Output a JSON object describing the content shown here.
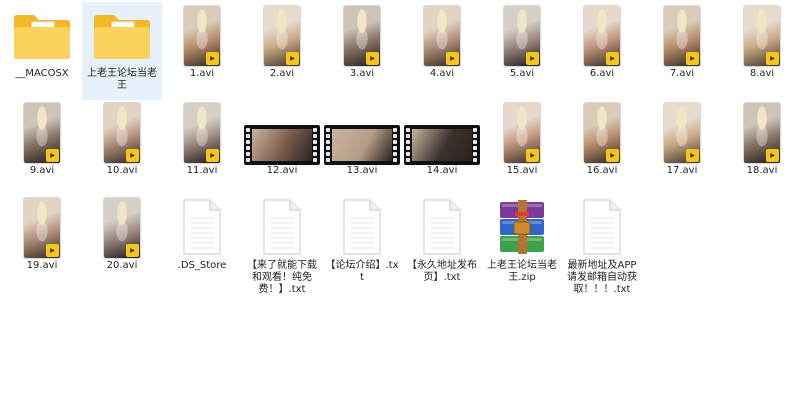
{
  "items": [
    {
      "label": "__MACOSX",
      "kind": "folder"
    },
    {
      "label": "上老王论坛当老王",
      "kind": "folder",
      "selected": true
    },
    {
      "label": "1.avi",
      "kind": "pvideo"
    },
    {
      "label": "2.avi",
      "kind": "pvideo"
    },
    {
      "label": "3.avi",
      "kind": "pvideo"
    },
    {
      "label": "4.avi",
      "kind": "pvideo"
    },
    {
      "label": "5.avi",
      "kind": "pvideo"
    },
    {
      "label": "6.avi",
      "kind": "pvideo"
    },
    {
      "label": "7.avi",
      "kind": "pvideo"
    },
    {
      "label": "8.avi",
      "kind": "pvideo"
    },
    {
      "label": "9.avi",
      "kind": "pvideo"
    },
    {
      "label": "10.avi",
      "kind": "pvideo"
    },
    {
      "label": "11.avi",
      "kind": "pvideo"
    },
    {
      "label": "12.avi",
      "kind": "lvideo"
    },
    {
      "label": "13.avi",
      "kind": "lvideo"
    },
    {
      "label": "14.avi",
      "kind": "lvideo"
    },
    {
      "label": "15.avi",
      "kind": "pvideo"
    },
    {
      "label": "16.avi",
      "kind": "pvideo"
    },
    {
      "label": "17.avi",
      "kind": "pvideo"
    },
    {
      "label": "18.avi",
      "kind": "pvideo"
    },
    {
      "label": "19.avi",
      "kind": "pvideo"
    },
    {
      "label": "20.avi",
      "kind": "pvideo"
    },
    {
      "label": ".DS_Store",
      "kind": "doc"
    },
    {
      "label": "【来了就能下载和观看！纯免费！】.txt",
      "kind": "doc"
    },
    {
      "label": "【论坛介绍】.txt",
      "kind": "doc"
    },
    {
      "label": "【永久地址发布页】.txt",
      "kind": "doc"
    },
    {
      "label": "上老王论坛当老王.zip",
      "kind": "zip"
    },
    {
      "label": "最新地址及APP请发邮箱自动获取！！！.txt",
      "kind": "doc"
    }
  ],
  "badge": "Player",
  "colors": {
    "folder_back": "#f3b728",
    "folder_front": "#fbd35c",
    "selection": "#e6f1fb",
    "badge": "#f5c518"
  },
  "icons": {
    "folder": "folder-icon",
    "pvideo": "video-thumbnail-icon",
    "lvideo": "film-strip-icon",
    "doc": "text-document-icon",
    "zip": "winrar-archive-icon"
  }
}
